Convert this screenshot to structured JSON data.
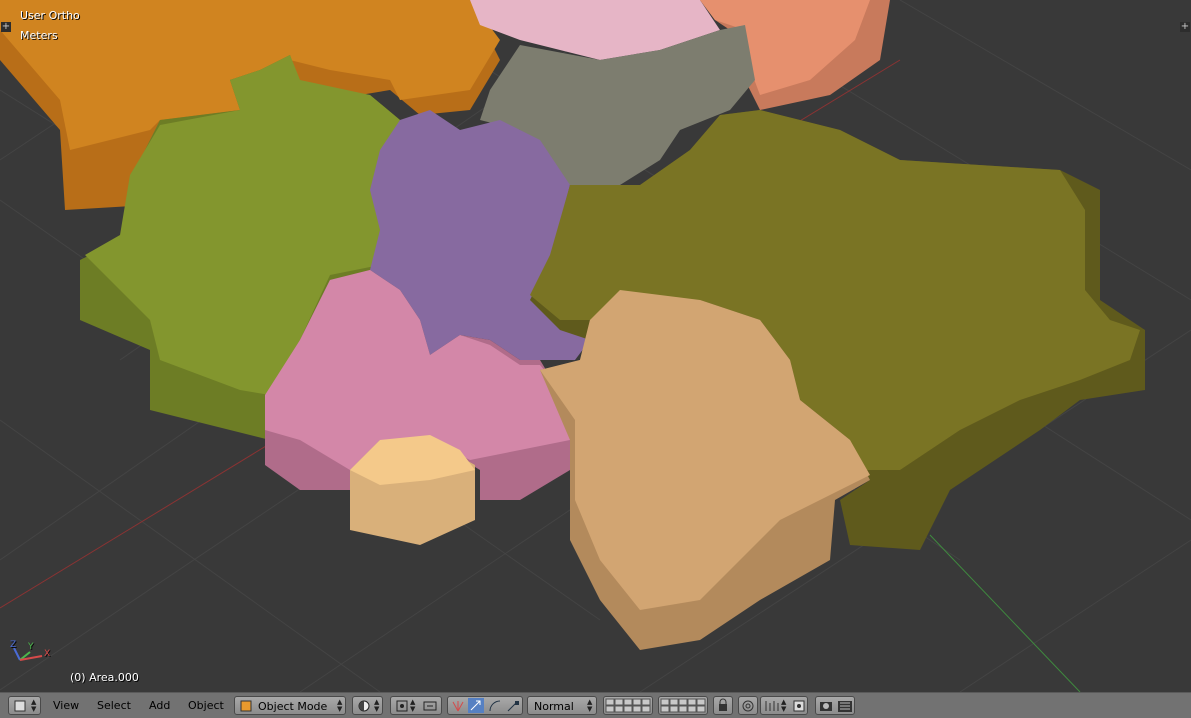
{
  "viewport": {
    "view_name": "User Ortho",
    "units": "Meters",
    "object_info": "(0) Area.000",
    "axes": {
      "x": "X",
      "y": "Y",
      "z": "Z"
    }
  },
  "colors": {
    "background": "#393939",
    "grid": "#444444",
    "x_axis": "#8a3333",
    "y_axis": "#3f8a3f",
    "regions": [
      "#d08420",
      "#e6b5c6",
      "#e6906e",
      "#7d7d6f",
      "#83962e",
      "#876aa0",
      "#7a7424",
      "#d387a8",
      "#d2a572",
      "#f4c98a"
    ]
  },
  "header": {
    "menus": [
      "View",
      "Select",
      "Add",
      "Object"
    ],
    "mode": "Object Mode",
    "pivot_icon": "viewport-shading-icon",
    "orientation": "Normal",
    "icons": [
      "editor-type-icon",
      "viewport-shading-icon",
      "pivot-point-icon",
      "manipulator-icon",
      "translate-icon",
      "rotate-icon",
      "scale-icon",
      "layers-icon",
      "lock-icon",
      "proportional-edit-icon",
      "snap-icon",
      "opengl-render-icon",
      "render-anim-icon"
    ]
  }
}
